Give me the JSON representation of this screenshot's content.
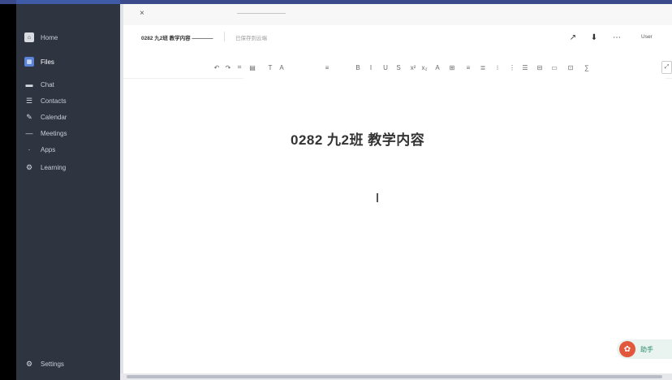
{
  "sidebar": {
    "items": [
      {
        "label": "Home",
        "icon": "home-icon",
        "glyph": "⌂"
      },
      {
        "label": "Files",
        "icon": "file-icon",
        "glyph": "▦"
      },
      {
        "label": "Chat",
        "icon": "chat-icon",
        "glyph": "▬"
      },
      {
        "label": "Contacts",
        "icon": "contacts-icon",
        "glyph": "☰"
      },
      {
        "label": "Calendar",
        "icon": "calendar-icon",
        "glyph": "✎"
      },
      {
        "label": "Meetings",
        "icon": "meetings-icon",
        "glyph": "—"
      },
      {
        "label": "Apps",
        "icon": "apps-icon",
        "glyph": "·"
      },
      {
        "label": "Learning",
        "icon": "learning-icon",
        "glyph": "⚙"
      }
    ],
    "bottom_label": "Settings",
    "bottom_glyph": "⚙"
  },
  "tab": {
    "close_glyph": "×",
    "title": "——————————"
  },
  "doc": {
    "name": "0282 九2班 教学内容 ————",
    "state": "已保存到云端",
    "heading": "0282 九2班 教学内容"
  },
  "toolbar": {
    "user": "User",
    "icons": [
      {
        "name": "share-icon",
        "glyph": "↗"
      },
      {
        "name": "download-icon",
        "glyph": "⬇"
      },
      {
        "name": "more-icon",
        "glyph": "⋯"
      }
    ]
  },
  "format": {
    "glyphs": [
      "↶",
      "↷",
      "⌗",
      "▤",
      "T",
      "A",
      "≡",
      "B",
      "I",
      "U",
      "S",
      "x²",
      "x₂",
      "A",
      "⊞",
      "≡",
      "≣",
      "⁝",
      "⋮",
      "☰",
      "⊟",
      "▭",
      "⊡",
      "∑"
    ],
    "end_glyph": "⤢"
  },
  "helper": {
    "label": "助手",
    "logo_glyph": "✿"
  },
  "colors": {
    "sidebar_bg": "#2e3440",
    "accent": "#3f5aa6",
    "helper_logo": "#e2583c"
  }
}
